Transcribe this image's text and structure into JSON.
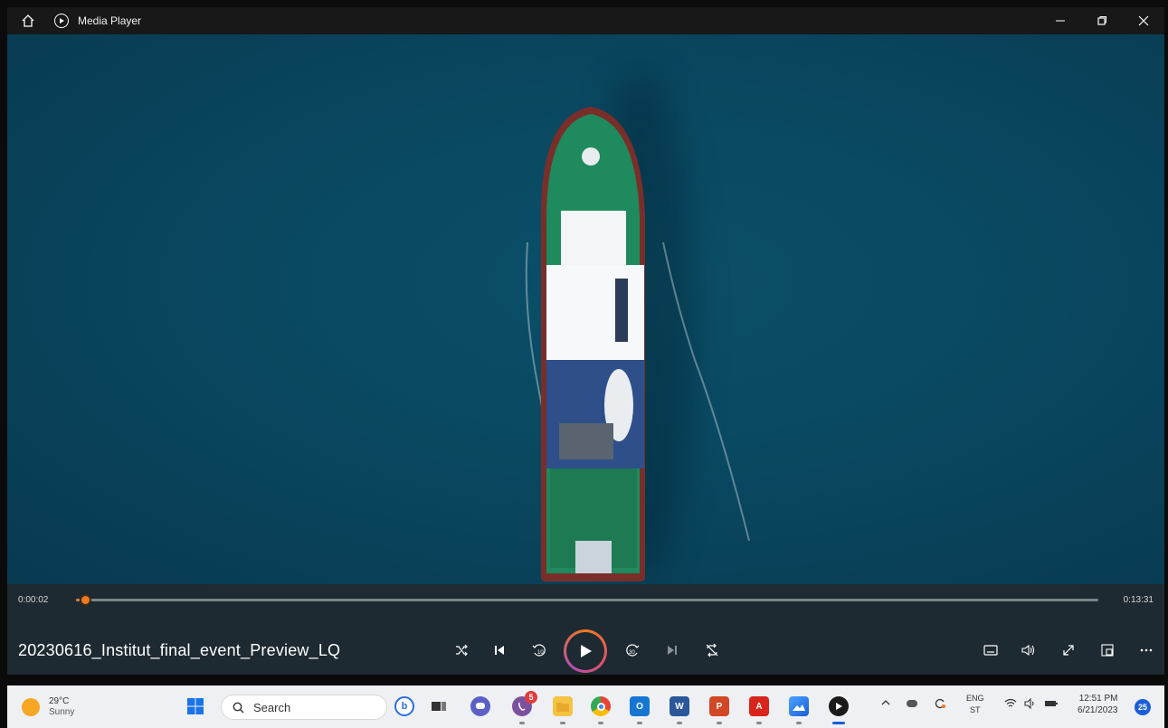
{
  "window": {
    "title": "Media Player",
    "icons": {
      "home": "home-icon",
      "app": "media-player-icon",
      "minimize": "minimize-icon",
      "maximize": "restore-icon",
      "close": "close-icon"
    }
  },
  "player": {
    "current_time": "0:00:02",
    "total_time": "0:13:31",
    "progress_fraction": 0.0025,
    "file_title": "20230616_Institut_final_event_Preview_LQ",
    "controls": [
      "shuffle-icon",
      "previous-icon",
      "skip-back-10-icon",
      "play-icon",
      "skip-forward-30-icon",
      "next-icon",
      "repeat-off-icon"
    ],
    "right_controls": [
      "subtitles-icon",
      "volume-icon",
      "fullscreen-icon",
      "mini-player-icon",
      "more-icon"
    ],
    "accent_color": "#f07a1f"
  },
  "taskbar": {
    "weather": {
      "temp": "29°C",
      "condition": "Sunny"
    },
    "search_placeholder": "Search",
    "viber_badge": "5",
    "tray": {
      "lang_top": "ENG",
      "lang_bottom": "ST",
      "time": "12:51 PM",
      "date": "6/21/2023",
      "notifications": "25"
    },
    "pinned": [
      "windows-start-icon",
      "bing-icon",
      "task-view-icon",
      "chat-icon",
      "viber-icon",
      "file-explorer-icon",
      "chrome-icon",
      "outlook-icon",
      "word-icon",
      "powerpoint-icon",
      "acrobat-icon",
      "photos-icon",
      "media-player-icon"
    ]
  }
}
